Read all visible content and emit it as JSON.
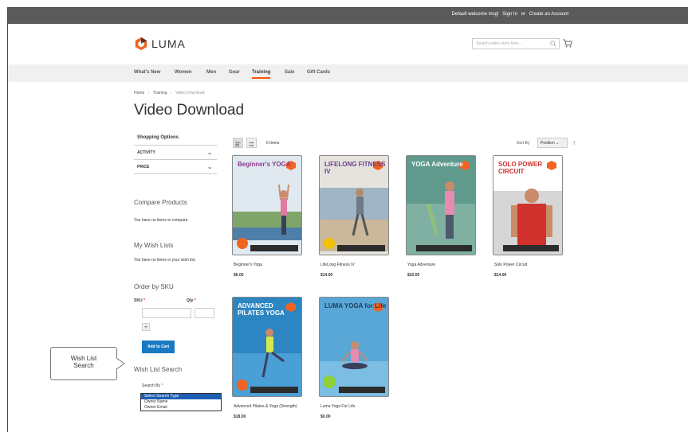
{
  "topbar": {
    "welcome": "Default welcome msg!",
    "sign_in": "Sign In",
    "or": "or",
    "create_account": "Create an Account"
  },
  "header": {
    "logo_text": "LUMA",
    "search_placeholder": "Search entire store here...",
    "brand_colors": {
      "orange": "#f26322",
      "blue": "#1979c3",
      "dark": "#333333"
    }
  },
  "nav": {
    "items": [
      {
        "label": "What's New"
      },
      {
        "label": "Women"
      },
      {
        "label": "Men"
      },
      {
        "label": "Gear"
      },
      {
        "label": "Training",
        "active": true
      },
      {
        "label": "Sale"
      },
      {
        "label": "Gift Cards"
      }
    ],
    "active_color": "#ff5501"
  },
  "breadcrumb": {
    "home": "Home",
    "sep": "›",
    "training": "Training",
    "current": "Video Download"
  },
  "page_title": "Video Download",
  "sidebar": {
    "shopping_options": "Shopping Options",
    "filters": [
      {
        "label": "ACTIVITY"
      },
      {
        "label": "PRICE"
      }
    ],
    "compare_title": "Compare Products",
    "compare_text": "You have no items to compare.",
    "wishlist_title": "My Wish Lists",
    "wishlist_text": "You have no items in your wish list.",
    "order_by_sku_title": "Order by SKU",
    "sku_label": "SKU",
    "qty_label": "Qty",
    "required_mark": "*",
    "add_to_cart": "Add to Cart",
    "wishlist_search_title": "Wish List Search",
    "search_by_label": "Search By",
    "search_by_options": [
      "Select Search Type",
      "Owner Name",
      "Owner Email"
    ],
    "search_by_selected": "Select Search Type"
  },
  "callout": {
    "line1": "Wish List",
    "line2": "Search"
  },
  "toolbar": {
    "items_count": "6 Items",
    "sort_label": "Sort By",
    "sort_value": "Position"
  },
  "products": [
    {
      "name": "Beginner's Yoga",
      "price": "$6.00",
      "cover_title": "Beginner's YOGA",
      "cover_bg": "#dfe9ef",
      "title_color": "#8a3a8f"
    },
    {
      "name": "LifeLong Fitness IV",
      "price": "$14.00",
      "cover_title": "LIFELONG FITNESS IV",
      "cover_bg": "#e6e3df",
      "title_color": "#6a3f8a"
    },
    {
      "name": "Yoga Adventure",
      "price": "$22.00",
      "cover_title": "YOGA Adventure",
      "cover_bg": "#5f9a8d",
      "title_color": "#ffffff"
    },
    {
      "name": "Solo Power Circuit",
      "price": "$14.00",
      "cover_title": "SOLO POWER CIRCUIT",
      "cover_bg": "#ffffff",
      "title_color": "#d0312d"
    },
    {
      "name": "Advanced Pilates & Yoga (Strength)",
      "price": "$18.00",
      "cover_title": "ADVANCED PILATES YOGA",
      "cover_bg": "#2d86c2",
      "title_color": "#ffffff"
    },
    {
      "name": "Luma Yoga For Life",
      "price": "$0.00",
      "cover_title": "LUMA YOGA for Life",
      "cover_bg": "#58a7d6",
      "title_color": "#1d3c5c"
    }
  ]
}
